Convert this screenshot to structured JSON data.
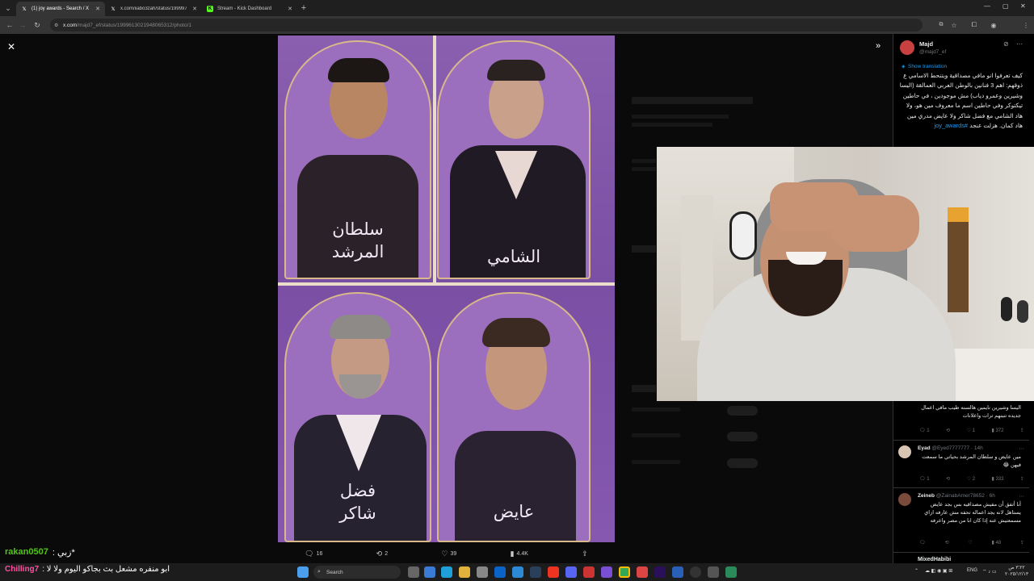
{
  "browser": {
    "tabs": [
      {
        "label": "(1) joy awards - Search / X",
        "icon": "x-logo-icon",
        "active": true
      },
      {
        "label": "x.com/iiabo3zah/status/199997...",
        "icon": "x-logo-icon",
        "active": false
      },
      {
        "label": "Stream - Kick Dashboard",
        "icon": "kick-logo-icon",
        "active": false
      }
    ],
    "new_tab": "+",
    "url_host": "x.com",
    "url_path": "/majd7_ef/status/1999613021948065312/photo/1"
  },
  "viewer": {
    "close_icon": "✕",
    "expand_icon": "»",
    "photo": {
      "names": [
        {
          "line1": "سلطان",
          "line2": "المرشد"
        },
        {
          "line1": "الشامي",
          "line2": ""
        },
        {
          "line1": "فضل",
          "line2": "شاكر"
        },
        {
          "line1": "عايض",
          "line2": ""
        }
      ]
    },
    "actions": {
      "replies": "16",
      "reposts": "2",
      "likes": "39",
      "views": "4.4K"
    }
  },
  "sidebar": {
    "author_name": "Majd",
    "author_handle": "@majd7_ef",
    "show_translation": "Show translation",
    "tweet_text": "كيف تعرفوا انو مافي مصداقية وبتنحط الاسامي ع ذوقهم: اهم 3 فنانين بالوطن العربي العمالقة (اليسا وشيرين وعمرو دياب) مش موجودين ، في حاطين تيكتوكر وفي حاطين اسم ما معروف مين هو، ولا هاد الشامي مع فضل شاكر ولا عايض مدري مين هاد كمان. هزلت عنجد",
    "hashtag": "#joy_awards",
    "replies": [
      {
        "text": "اليسا وشيرين نايمين هالسنه طيب مافي اعمال جديده تنبنهم ترات واعلانات",
        "stats": {
          "replies": "1",
          "reposts": "",
          "likes": "1",
          "views": "372"
        }
      },
      {
        "author": "Eyad",
        "handle": "@Eyed7777777 · 14h",
        "text": "مين عايض و سلطان المرشد بحياتي ما سمعت فيهن 😂",
        "stats": {
          "replies": "1",
          "reposts": "",
          "likes": "2",
          "views": "333"
        }
      },
      {
        "author": "Zeineb",
        "handle": "@ZainabAmer78652 · 6h",
        "text": "أنا أتفق أن مفيش مصداقيه بس بجد عايض يستاهل لانه بجد اعماله تحفه مش عارفه ازاي مسمعتيش عنه إذا كان انا من مصر واعرفه",
        "stats": {
          "replies": "",
          "reposts": "",
          "likes": "",
          "views": "48"
        }
      }
    ],
    "partial_author": "MixedHabibi"
  },
  "stream_overlay": {
    "chat_user": "rakan0507",
    "chat_message": "*زبي :",
    "streamer_name": "Chilling7",
    "stream_title": "ابو منفره مشعل بث بجاكو اليوم ولا لا :"
  },
  "taskbar": {
    "search_placeholder": "Search",
    "language": "ENG",
    "clock_time": "٣:٢٢ ص",
    "clock_date": "٢٠٢٥/١٢/١٣"
  },
  "colors": {
    "x_blue": "#1d9bf0",
    "photo_purple": "#7a4fa4",
    "gold_frame": "#d9b98a",
    "chat_green": "#53c41a",
    "streamer_pink": "#ff4fa3"
  }
}
